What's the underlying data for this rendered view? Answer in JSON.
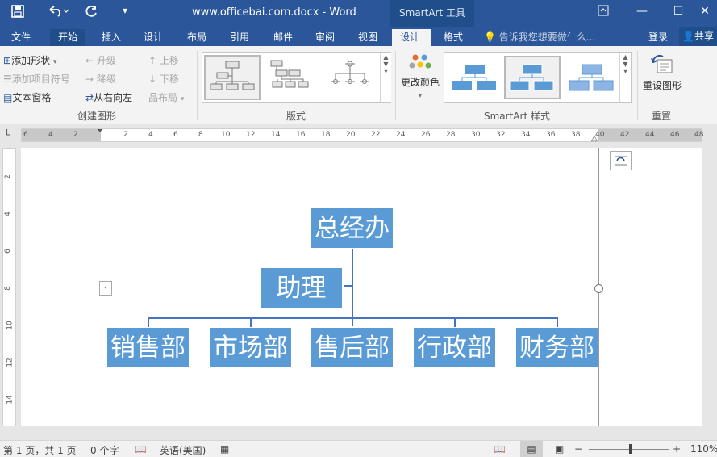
{
  "title_bar": {
    "document_title": "www.officebai.com.docx - Word",
    "context_tools": "SmartArt 工具",
    "quick_access": {
      "save_icon": "save-icon",
      "undo_icon": "undo-icon",
      "redo_icon": "redo-icon",
      "customize_icon": "customize-icon"
    },
    "window_controls": {
      "restore_ribbon": "ribbon-display-icon",
      "minimize": "minimize-icon",
      "maximize": "maximize-icon",
      "close": "close-icon"
    }
  },
  "tabs": [
    "文件",
    "开始",
    "插入",
    "设计",
    "布局",
    "引用",
    "邮件",
    "审阅",
    "视图",
    "设计",
    "格式"
  ],
  "active_tab": "设计",
  "tell_me": "告诉我您想要做什么...",
  "login": "登录",
  "share": "共享",
  "ribbon": {
    "create_graphic": {
      "label": "创建图形",
      "add_shape": "添加形状",
      "add_bullet": "添加项目符号",
      "text_pane": "文本窗格",
      "promote": "升级",
      "demote": "降级",
      "right_to_left": "从右向左",
      "move_up": "上移",
      "move_down": "下移",
      "layout": "布局"
    },
    "layouts": {
      "label": "版式"
    },
    "styles": {
      "label": "SmartArt 样式",
      "change_colors": "更改颜色"
    },
    "reset": {
      "label": "重置",
      "reset_graphic": "重设图形"
    }
  },
  "ruler": {
    "horizontal_ticks": [
      "6",
      "4",
      "2",
      "2",
      "4",
      "6",
      "8",
      "10",
      "12",
      "14",
      "16",
      "18",
      "20",
      "22",
      "24",
      "26",
      "28",
      "30",
      "32",
      "34",
      "36",
      "38",
      "40",
      "42",
      "44",
      "46",
      "48"
    ],
    "vertical_ticks": [
      "2",
      "4",
      "6",
      "8",
      "10",
      "12",
      "14"
    ]
  },
  "smartart": {
    "top": "总经办",
    "assistant": "助理",
    "departments": [
      "销售部",
      "市场部",
      "售后部",
      "行政部",
      "财务部"
    ]
  },
  "status_bar": {
    "page": "第 1 页，共 1 页",
    "words": "0 个字",
    "language": "英语(美国)",
    "zoom": "110%"
  },
  "colors": {
    "title_blue": "#2b579a",
    "node_blue": "#5b9bd5",
    "connector": "#4472c4"
  }
}
